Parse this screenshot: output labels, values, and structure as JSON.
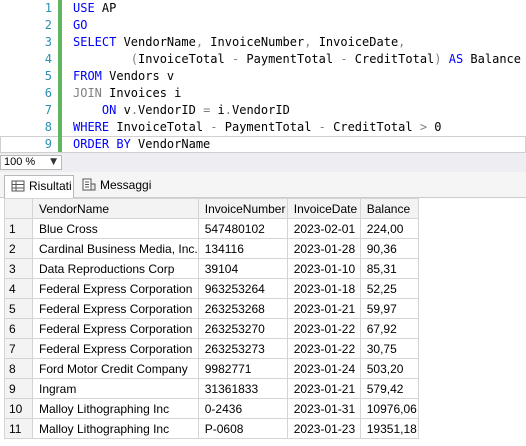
{
  "editor": {
    "lines": [
      {
        "n": "1",
        "segs": [
          {
            "t": "USE",
            "c": "kw"
          },
          {
            "t": " AP",
            "c": ""
          }
        ]
      },
      {
        "n": "2",
        "segs": [
          {
            "t": "GO",
            "c": "kw"
          }
        ]
      },
      {
        "n": "3",
        "segs": [
          {
            "t": "SELECT",
            "c": "kw"
          },
          {
            "t": " VendorName",
            "c": ""
          },
          {
            "t": ",",
            "c": "op"
          },
          {
            "t": " InvoiceNumber",
            "c": ""
          },
          {
            "t": ",",
            "c": "op"
          },
          {
            "t": " InvoiceDate",
            "c": ""
          },
          {
            "t": ",",
            "c": "op"
          }
        ]
      },
      {
        "n": "4",
        "segs": [
          {
            "t": "        ",
            "c": ""
          },
          {
            "t": "(",
            "c": "op"
          },
          {
            "t": "InvoiceTotal ",
            "c": ""
          },
          {
            "t": "-",
            "c": "op"
          },
          {
            "t": " PaymentTotal ",
            "c": ""
          },
          {
            "t": "-",
            "c": "op"
          },
          {
            "t": " CreditTotal",
            "c": ""
          },
          {
            "t": ")",
            "c": "op"
          },
          {
            "t": " AS",
            "c": "kw"
          },
          {
            "t": " Balance",
            "c": ""
          }
        ]
      },
      {
        "n": "5",
        "segs": [
          {
            "t": "FROM",
            "c": "kw"
          },
          {
            "t": " Vendors v",
            "c": ""
          }
        ]
      },
      {
        "n": "6",
        "segs": [
          {
            "t": "JOIN",
            "c": "op"
          },
          {
            "t": " Invoices i",
            "c": ""
          }
        ]
      },
      {
        "n": "7",
        "segs": [
          {
            "t": "    ",
            "c": ""
          },
          {
            "t": "ON",
            "c": "kw"
          },
          {
            "t": " v",
            "c": ""
          },
          {
            "t": ".",
            "c": "op"
          },
          {
            "t": "VendorID ",
            "c": ""
          },
          {
            "t": "=",
            "c": "op"
          },
          {
            "t": " i",
            "c": ""
          },
          {
            "t": ".",
            "c": "op"
          },
          {
            "t": "VendorID",
            "c": ""
          }
        ]
      },
      {
        "n": "8",
        "segs": [
          {
            "t": "WHERE",
            "c": "kw"
          },
          {
            "t": " InvoiceTotal ",
            "c": ""
          },
          {
            "t": "-",
            "c": "op"
          },
          {
            "t": " PaymentTotal ",
            "c": ""
          },
          {
            "t": "-",
            "c": "op"
          },
          {
            "t": " CreditTotal ",
            "c": ""
          },
          {
            "t": ">",
            "c": "op"
          },
          {
            "t": " 0",
            "c": ""
          }
        ]
      },
      {
        "n": "9",
        "segs": [
          {
            "t": "ORDER BY",
            "c": "kw"
          },
          {
            "t": " VendorName",
            "c": ""
          }
        ]
      }
    ]
  },
  "statusbar": {
    "zoom": "100 %"
  },
  "tabs": {
    "results": "Risultati",
    "messages": "Messaggi"
  },
  "grid": {
    "columns": [
      "VendorName",
      "InvoiceNumber",
      "InvoiceDate",
      "Balance"
    ],
    "rows": [
      [
        "1",
        "Blue Cross",
        "547480102",
        "2023-02-01",
        "224,00"
      ],
      [
        "2",
        "Cardinal Business Media, Inc.",
        "134116",
        "2023-01-28",
        "90,36"
      ],
      [
        "3",
        "Data Reproductions Corp",
        "39104",
        "2023-01-10",
        "85,31"
      ],
      [
        "4",
        "Federal Express Corporation",
        "963253264",
        "2023-01-18",
        "52,25"
      ],
      [
        "5",
        "Federal Express Corporation",
        "263253268",
        "2023-01-21",
        "59,97"
      ],
      [
        "6",
        "Federal Express Corporation",
        "263253270",
        "2023-01-22",
        "67,92"
      ],
      [
        "7",
        "Federal Express Corporation",
        "263253273",
        "2023-01-22",
        "30,75"
      ],
      [
        "8",
        "Ford Motor Credit Company",
        "9982771",
        "2023-01-24",
        "503,20"
      ],
      [
        "9",
        "Ingram",
        "31361833",
        "2023-01-21",
        "579,42"
      ],
      [
        "10",
        "Malloy Lithographing Inc",
        "0-2436",
        "2023-01-31",
        "10976,06"
      ],
      [
        "11",
        "Malloy Lithographing Inc",
        "P-0608",
        "2023-01-23",
        "19351,18"
      ]
    ]
  }
}
